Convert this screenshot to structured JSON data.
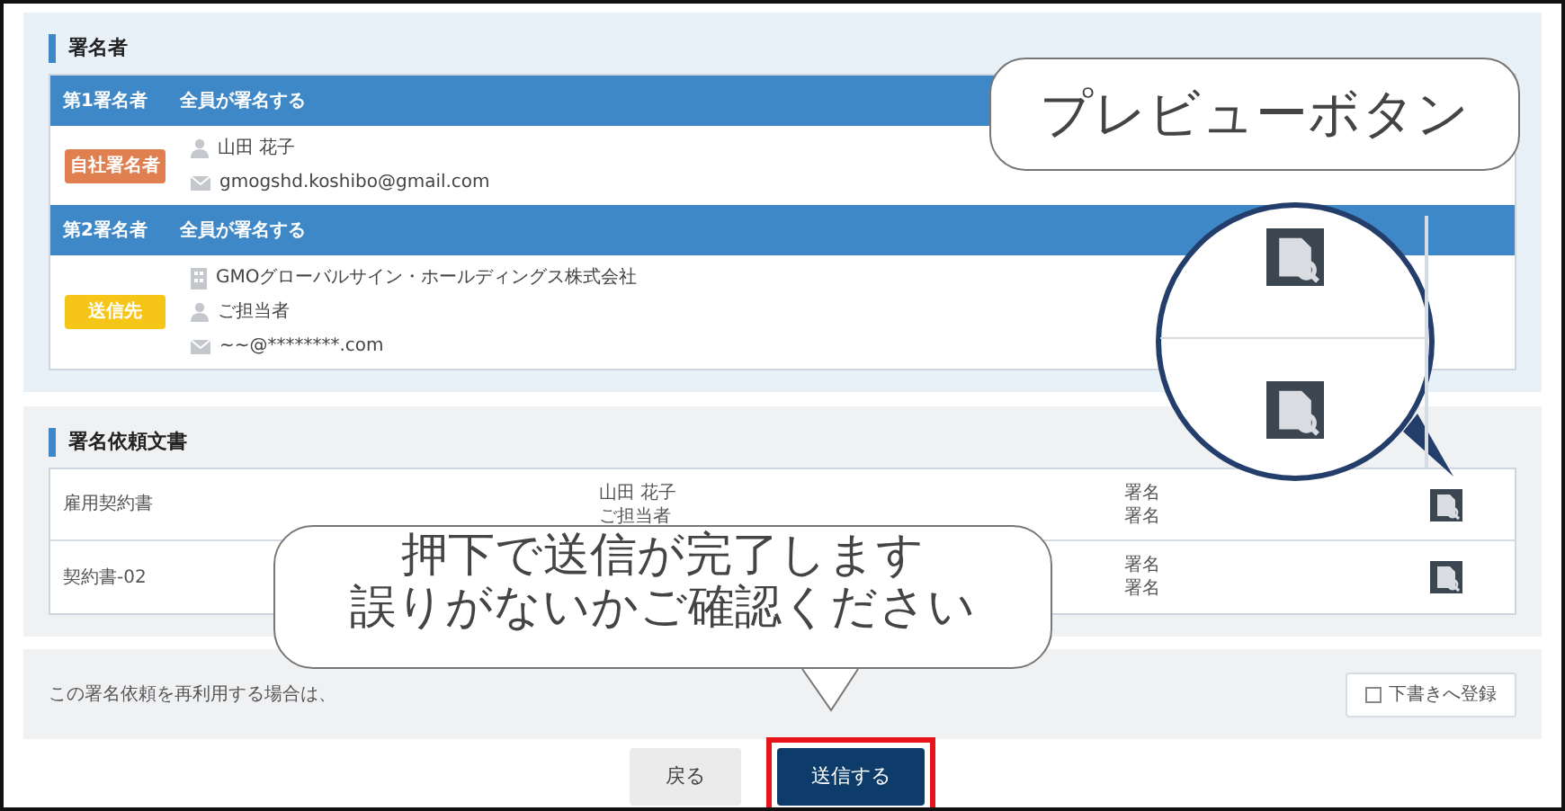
{
  "signers_section": {
    "title": "署名者",
    "signers": [
      {
        "order": "第1署名者",
        "mode": "全員が署名する",
        "tag": "自社署名者",
        "color": "#e07f4f",
        "lines": [
          {
            "kind": "person",
            "text": "山田 花子"
          },
          {
            "kind": "mail",
            "text": "gmogshd.koshibo@gmail.com"
          }
        ]
      },
      {
        "order": "第2署名者",
        "mode": "全員が署名する",
        "tag": "送信先",
        "color": "#f5c518",
        "lines": [
          {
            "kind": "company",
            "text": "GMOグローバルサイン・ホールディングス株式会社"
          },
          {
            "kind": "person",
            "text": "ご担当者"
          },
          {
            "kind": "mail",
            "text": "~~@********.com"
          }
        ]
      }
    ]
  },
  "documents_section": {
    "title": "署名依頼文書",
    "rows": [
      {
        "name": "雇用契約書",
        "signers": [
          "山田 花子",
          "ご担当者"
        ],
        "statuses": [
          "署名",
          "署名"
        ]
      },
      {
        "name": "契約書-02",
        "signers": [],
        "statuses": [
          "署名",
          "署名"
        ]
      }
    ]
  },
  "footer": {
    "note": "この署名依頼を再利用する場合は、",
    "draft_checkbox": {
      "label": "下書きへ登録",
      "checked": false
    }
  },
  "buttons": [
    {
      "kind": "back",
      "label": "戻る"
    },
    {
      "kind": "send",
      "label": "送信する",
      "highlighted": true
    }
  ],
  "annotations": {
    "preview_callout": "プレビューボタン",
    "send_callout": [
      "押下で送信が完了します",
      "誤りがないかご確認ください"
    ]
  }
}
